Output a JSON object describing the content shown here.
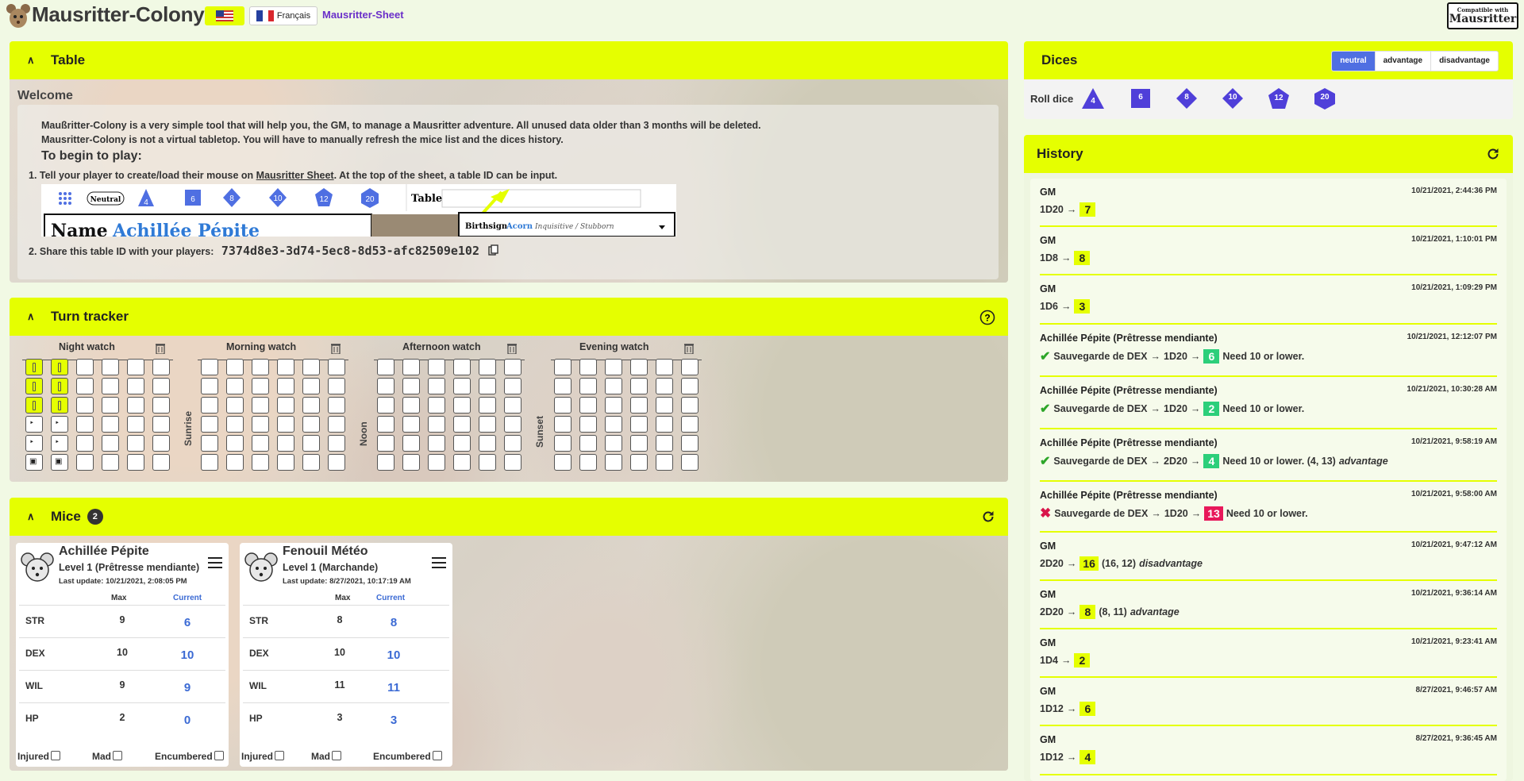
{
  "header": {
    "title": "Mausritter-Colony",
    "lang_fr_label": "Français",
    "sheet_link": "Mausritter-Sheet",
    "compat_small": "Compatible with",
    "compat_big": "Mausritter"
  },
  "table_panel": {
    "title": "Table",
    "welcome_title": "Welcome",
    "line1": "Maußritter-Colony is a very simple tool that will help you, the GM, to manage a Mausritter adventure. All unused data older than 3 months will be deleted.",
    "line2": "Mausritter-Colony is not a virtual tabletop. You will have to manually refresh the mice list and the dices history.",
    "begin_title": "To begin to play:",
    "step1_prefix": "1. Tell your player to create/load their mouse on ",
    "step1_link": "Mausritter Sheet",
    "step1_suffix": ". At the top of the sheet, a table ID can be input.",
    "step2_prefix": "2. Share this table ID with your players:",
    "table_id": "7374d8e3-3d74-5ec8-8d53-afc82509e102",
    "preview_neutral": "Neutral",
    "preview_table": "Table",
    "preview_name": "Name",
    "preview_mouse_name": "Achillée Pépite",
    "preview_birthsign": "Birthsign",
    "preview_acorn": "Acorn",
    "preview_traits": "Inquisitive / Stubborn",
    "preview_dice": [
      "4",
      "6",
      "8",
      "10",
      "12",
      "20"
    ]
  },
  "turn_tracker": {
    "title": "Turn tracker",
    "watches": [
      "Night watch",
      "Morning watch",
      "Afternoon watch",
      "Evening watch"
    ],
    "separators": [
      "Sunrise",
      "Noon",
      "Sunset"
    ]
  },
  "mice_panel": {
    "title": "Mice",
    "count": "2",
    "col_max": "Max",
    "col_current": "Current",
    "injured": "Injured",
    "mad": "Mad",
    "encumbered": "Encumbered",
    "mice": [
      {
        "name": "Achillée Pépite",
        "level": "Level 1 (Prêtresse mendiante)",
        "update": "Last update: 10/21/2021, 2:08:05 PM",
        "stats": [
          {
            "name": "STR",
            "max": "9",
            "current": "6"
          },
          {
            "name": "DEX",
            "max": "10",
            "current": "10"
          },
          {
            "name": "WIL",
            "max": "9",
            "current": "9"
          },
          {
            "name": "HP",
            "max": "2",
            "current": "0"
          }
        ]
      },
      {
        "name": "Fenouil Météo",
        "level": "Level 1 (Marchande)",
        "update": "Last update: 8/27/2021, 10:17:19 AM",
        "stats": [
          {
            "name": "STR",
            "max": "8",
            "current": "8"
          },
          {
            "name": "DEX",
            "max": "10",
            "current": "10"
          },
          {
            "name": "WIL",
            "max": "11",
            "current": "11"
          },
          {
            "name": "HP",
            "max": "3",
            "current": "3"
          }
        ]
      }
    ]
  },
  "dices_panel": {
    "title": "Dices",
    "modes": [
      "neutral",
      "advantage",
      "disadvantage"
    ],
    "active_mode": "neutral",
    "roll_label": "Roll dice",
    "dice": [
      "4",
      "6",
      "8",
      "10",
      "12",
      "20"
    ],
    "dice_color": "#4f3fd9"
  },
  "history_panel": {
    "title": "History",
    "items": [
      {
        "who": "GM",
        "time": "10/21/2021, 2:44:36 PM",
        "check": "",
        "roll": "1D20",
        "result": "7",
        "kind": "plain",
        "note": "",
        "mode": ""
      },
      {
        "who": "GM",
        "time": "10/21/2021, 1:10:01 PM",
        "check": "",
        "roll": "1D8",
        "result": "8",
        "kind": "plain",
        "note": "",
        "mode": ""
      },
      {
        "who": "GM",
        "time": "10/21/2021, 1:09:29 PM",
        "check": "",
        "roll": "1D6",
        "result": "3",
        "kind": "plain",
        "note": "",
        "mode": ""
      },
      {
        "who": "Achillée Pépite (Prêtresse mendiante)",
        "time": "10/21/2021, 12:12:07 PM",
        "check": "Sauvegarde de DEX",
        "roll": "1D20",
        "result": "6",
        "kind": "success",
        "note": "Need 10 or lower.",
        "mode": ""
      },
      {
        "who": "Achillée Pépite (Prêtresse mendiante)",
        "time": "10/21/2021, 10:30:28 AM",
        "check": "Sauvegarde de DEX",
        "roll": "1D20",
        "result": "2",
        "kind": "success",
        "note": "Need 10 or lower.",
        "mode": ""
      },
      {
        "who": "Achillée Pépite (Prêtresse mendiante)",
        "time": "10/21/2021, 9:58:19 AM",
        "check": "Sauvegarde de DEX",
        "roll": "2D20",
        "result": "4",
        "kind": "success",
        "note": "Need 10 or lower. (4, 13)",
        "mode": "advantage"
      },
      {
        "who": "Achillée Pépite (Prêtresse mendiante)",
        "time": "10/21/2021, 9:58:00 AM",
        "check": "Sauvegarde de DEX",
        "roll": "1D20",
        "result": "13",
        "kind": "fail",
        "note": "Need 10 or lower.",
        "mode": ""
      },
      {
        "who": "GM",
        "time": "10/21/2021, 9:47:12 AM",
        "check": "",
        "roll": "2D20",
        "result": "16",
        "kind": "plain",
        "note": "(16, 12)",
        "mode": "disadvantage"
      },
      {
        "who": "GM",
        "time": "10/21/2021, 9:36:14 AM",
        "check": "",
        "roll": "2D20",
        "result": "8",
        "kind": "plain",
        "note": "(8, 11)",
        "mode": "advantage"
      },
      {
        "who": "GM",
        "time": "10/21/2021, 9:23:41 AM",
        "check": "",
        "roll": "1D4",
        "result": "2",
        "kind": "plain",
        "note": "",
        "mode": ""
      },
      {
        "who": "GM",
        "time": "8/27/2021, 9:46:57 AM",
        "check": "",
        "roll": "1D12",
        "result": "6",
        "kind": "plain",
        "note": "",
        "mode": ""
      },
      {
        "who": "GM",
        "time": "8/27/2021, 9:36:45 AM",
        "check": "",
        "roll": "1D12",
        "result": "4",
        "kind": "plain",
        "note": "",
        "mode": ""
      }
    ]
  },
  "colors": {
    "accent": "#e5ff00",
    "primary": "#4f6fe2",
    "success": "#2ccf7a",
    "danger": "#e8185a"
  }
}
